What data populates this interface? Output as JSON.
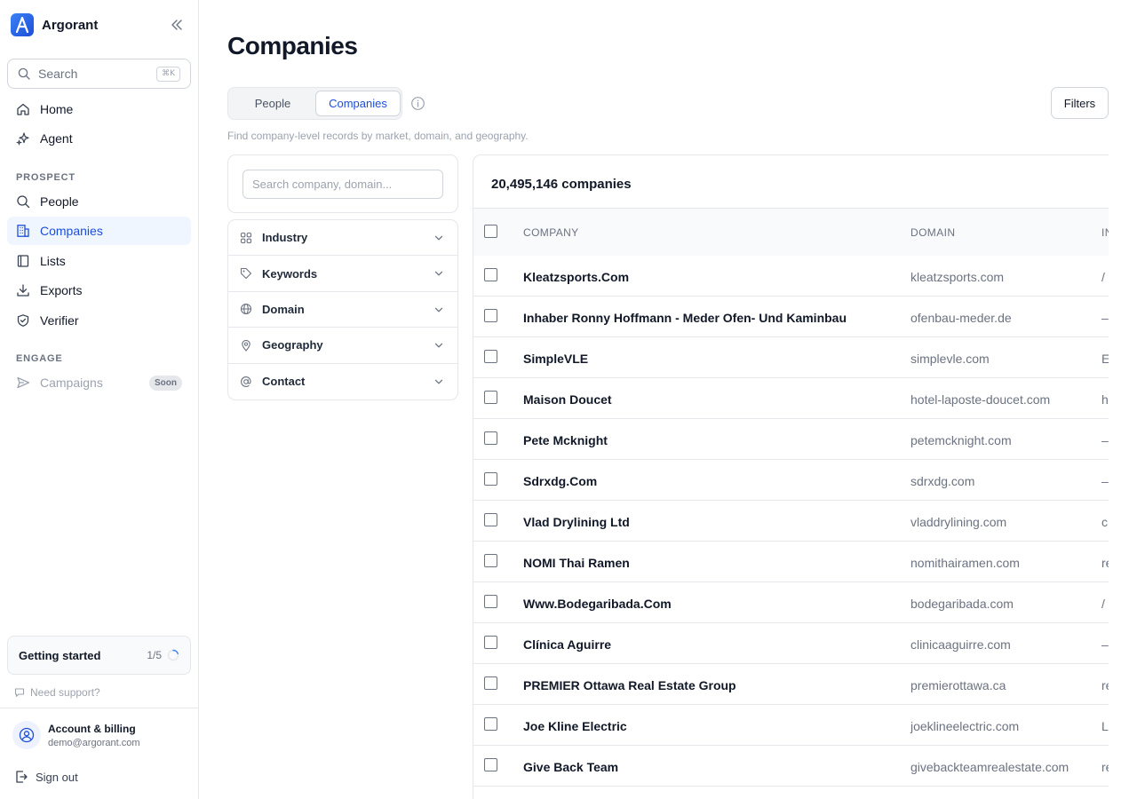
{
  "app": {
    "name": "Argorant"
  },
  "sidebar": {
    "search": {
      "placeholder": "Search",
      "shortcut": "⌘K"
    },
    "nav_top": [
      {
        "label": "Home",
        "icon": "home-icon"
      },
      {
        "label": "Agent",
        "icon": "sparkle-icon"
      }
    ],
    "section_prospect": "PROSPECT",
    "nav_prospect": [
      {
        "label": "People",
        "icon": "search-icon"
      },
      {
        "label": "Companies",
        "icon": "building-icon",
        "active": true
      },
      {
        "label": "Lists",
        "icon": "book-icon"
      },
      {
        "label": "Exports",
        "icon": "download-icon"
      },
      {
        "label": "Verifier",
        "icon": "shield-check-icon"
      }
    ],
    "section_engage": "ENGAGE",
    "nav_engage": [
      {
        "label": "Campaigns",
        "icon": "send-icon",
        "badge": "Soon",
        "disabled": true
      }
    ],
    "getting_started": {
      "title": "Getting started",
      "progress": "1/5"
    },
    "support": "Need support?",
    "account": {
      "title": "Account & billing",
      "email": "demo@argorant.com"
    },
    "sign_out": "Sign out"
  },
  "main": {
    "title": "Companies",
    "tabs": [
      {
        "label": "People"
      },
      {
        "label": "Companies",
        "active": true
      }
    ],
    "filters_button": "Filters",
    "subtitle": "Find company-level records by market, domain, and geography.",
    "filter_search_placeholder": "Search company, domain...",
    "filters": [
      {
        "label": "Industry",
        "icon": "grid-icon"
      },
      {
        "label": "Keywords",
        "icon": "tag-icon"
      },
      {
        "label": "Domain",
        "icon": "globe-icon"
      },
      {
        "label": "Geography",
        "icon": "map-pin-icon"
      },
      {
        "label": "Contact",
        "icon": "at-sign-icon"
      }
    ],
    "results_count": "20,495,146 companies",
    "columns": {
      "company": "COMPANY",
      "domain": "DOMAIN",
      "third": "IN"
    },
    "rows": [
      {
        "company": "Kleatzsports.Com",
        "domain": "kleatzsports.com",
        "extra": "/"
      },
      {
        "company": "Inhaber Ronny Hoffmann - Meder Ofen- Und Kaminbau",
        "domain": "ofenbau-meder.de",
        "extra": "–"
      },
      {
        "company": "SimpleVLE",
        "domain": "simplevle.com",
        "extra": "E"
      },
      {
        "company": "Maison Doucet",
        "domain": "hotel-laposte-doucet.com",
        "extra": "h"
      },
      {
        "company": "Pete Mcknight",
        "domain": "petemcknight.com",
        "extra": "–"
      },
      {
        "company": "Sdrxdg.Com",
        "domain": "sdrxdg.com",
        "extra": "–"
      },
      {
        "company": "Vlad Drylining Ltd",
        "domain": "vladdrylining.com",
        "extra": "c"
      },
      {
        "company": "NOMI Thai Ramen",
        "domain": "nomithairamen.com",
        "extra": "re"
      },
      {
        "company": "Www.Bodegaribada.Com",
        "domain": "bodegaribada.com",
        "extra": "/"
      },
      {
        "company": "Clínica Aguirre",
        "domain": "clinicaaguirre.com",
        "extra": "–"
      },
      {
        "company": "PREMIER Ottawa Real Estate Group",
        "domain": "premierottawa.ca",
        "extra": "re"
      },
      {
        "company": "Joe Kline Electric",
        "domain": "joeklineelectric.com",
        "extra": "L"
      },
      {
        "company": "Give Back Team",
        "domain": "givebackteamrealestate.com",
        "extra": "re"
      }
    ]
  }
}
